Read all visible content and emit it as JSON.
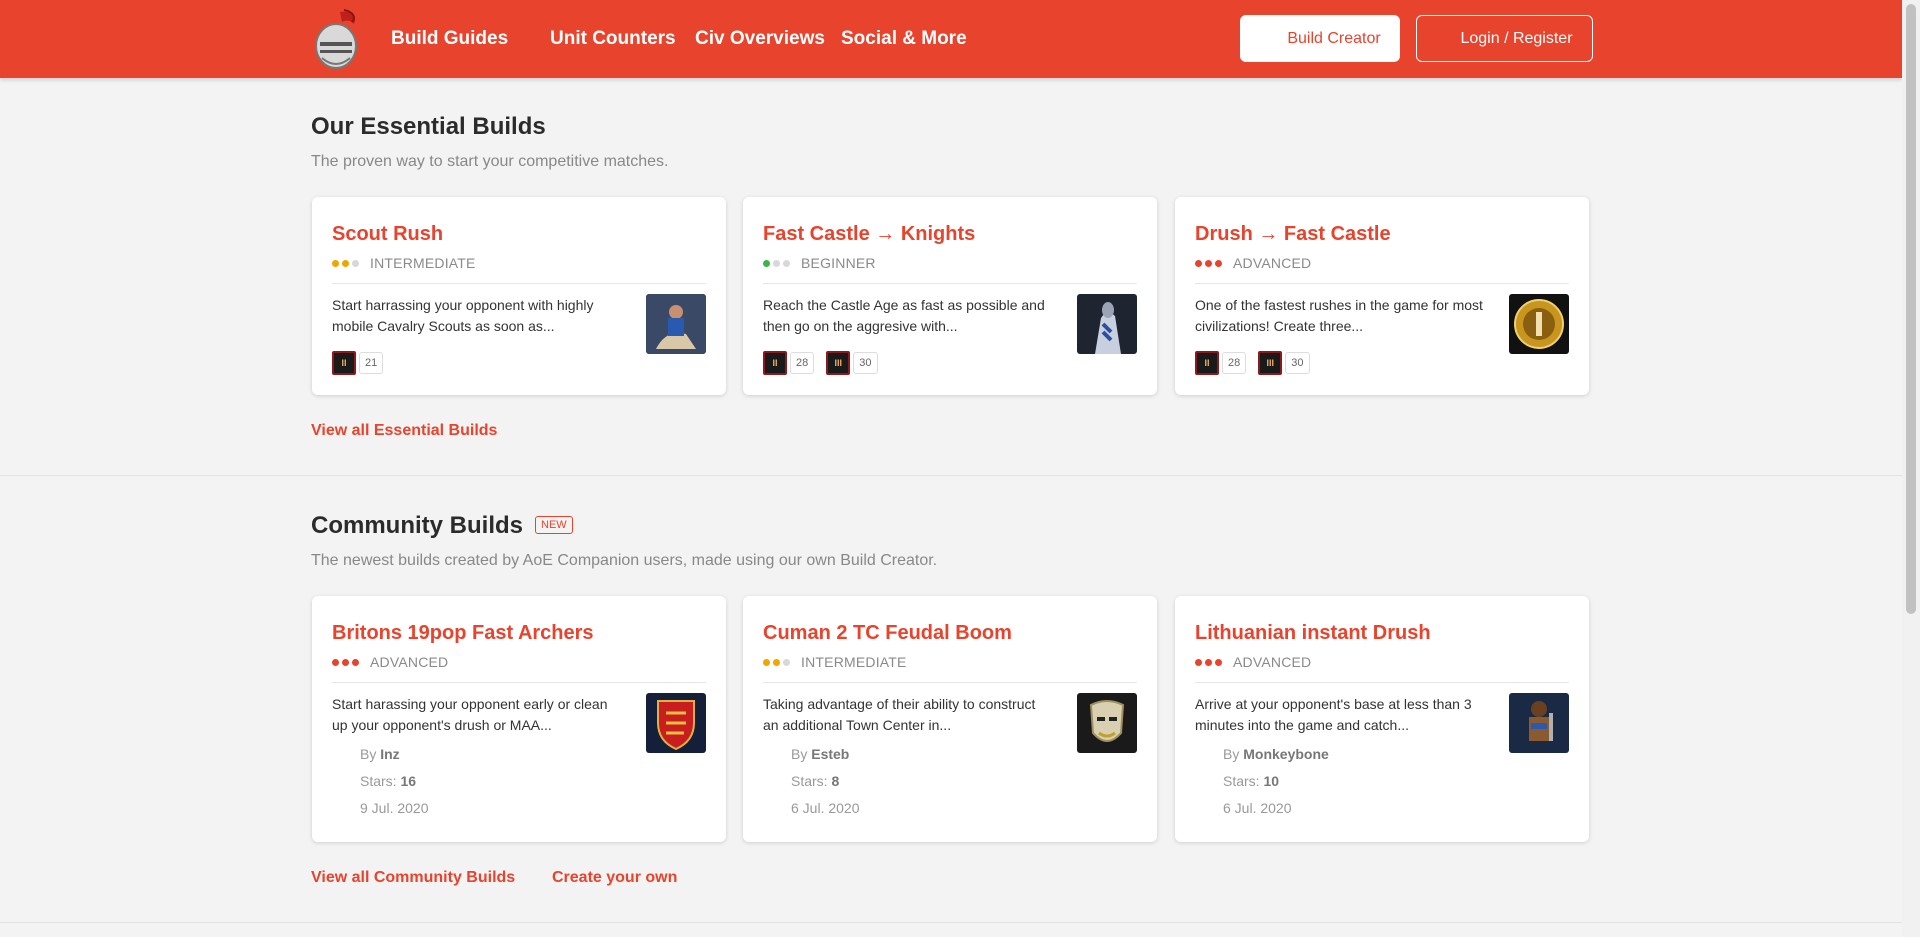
{
  "nav": {
    "links": [
      "Build Guides",
      "Unit Counters",
      "Civ Overviews",
      "Social & More"
    ],
    "build_creator": "Build Creator",
    "login": "Login / Register"
  },
  "colors": {
    "accent": "#e8432d",
    "beginner": "#3bb54a",
    "intermediate": "#f0a500",
    "advanced": "#e8432d"
  },
  "essential": {
    "title": "Our Essential Builds",
    "subtitle": "The proven way to start your competitive matches.",
    "view_all": "View all Essential Builds",
    "cards": [
      {
        "title": "Scout Rush",
        "difficulty": "INTERMEDIATE",
        "level": 2,
        "desc": "Start harrassing your opponent with highly mobile Cavalry Scouts as soon as...",
        "thumb": "scout-cavalry-icon",
        "ages": [
          {
            "icon": "feudal-age-icon",
            "label": "II",
            "count": "21"
          }
        ]
      },
      {
        "title": "Fast Castle → Knights",
        "difficulty": "BEGINNER",
        "level": 1,
        "desc": "Reach the Castle Age as fast as possible and then go on the aggresive with...",
        "thumb": "knight-icon",
        "ages": [
          {
            "icon": "feudal-age-icon",
            "label": "II",
            "count": "28"
          },
          {
            "icon": "castle-age-icon",
            "label": "III",
            "count": "30"
          }
        ]
      },
      {
        "title": "Drush → Fast Castle",
        "difficulty": "ADVANCED",
        "level": 3,
        "desc": "One of the fastest rushes in the game for most civilizations! Create three...",
        "thumb": "militia-drush-icon",
        "ages": [
          {
            "icon": "feudal-age-icon",
            "label": "II",
            "count": "28"
          },
          {
            "icon": "castle-age-icon",
            "label": "III",
            "count": "30"
          }
        ]
      }
    ]
  },
  "community": {
    "title": "Community Builds",
    "badge": "NEW",
    "subtitle": "The newest builds created by AoE Companion users, made using our own Build Creator.",
    "view_all": "View all Community Builds",
    "create": "Create your own",
    "by_label": "By",
    "stars_label": "Stars:",
    "cards": [
      {
        "title": "Britons 19pop Fast Archers",
        "difficulty": "ADVANCED",
        "level": 3,
        "desc": "Start harassing your opponent early or clean up your opponent's drush or MAA...",
        "thumb": "britons-shield-icon",
        "author": "Inz",
        "stars": "16",
        "date": "9 Jul. 2020"
      },
      {
        "title": "Cuman 2 TC Feudal Boom",
        "difficulty": "INTERMEDIATE",
        "level": 2,
        "desc": "Taking advantage of their ability to construct an additional Town Center in...",
        "thumb": "cumans-mask-icon",
        "author": "Esteb",
        "stars": "8",
        "date": "6 Jul. 2020"
      },
      {
        "title": "Lithuanian instant Drush",
        "difficulty": "ADVANCED",
        "level": 3,
        "desc": "Arrive at your opponent's base at less than 3 minutes into the game and catch...",
        "thumb": "militia-unit-icon",
        "author": "Monkeybone",
        "stars": "10",
        "date": "6 Jul. 2020"
      }
    ]
  }
}
